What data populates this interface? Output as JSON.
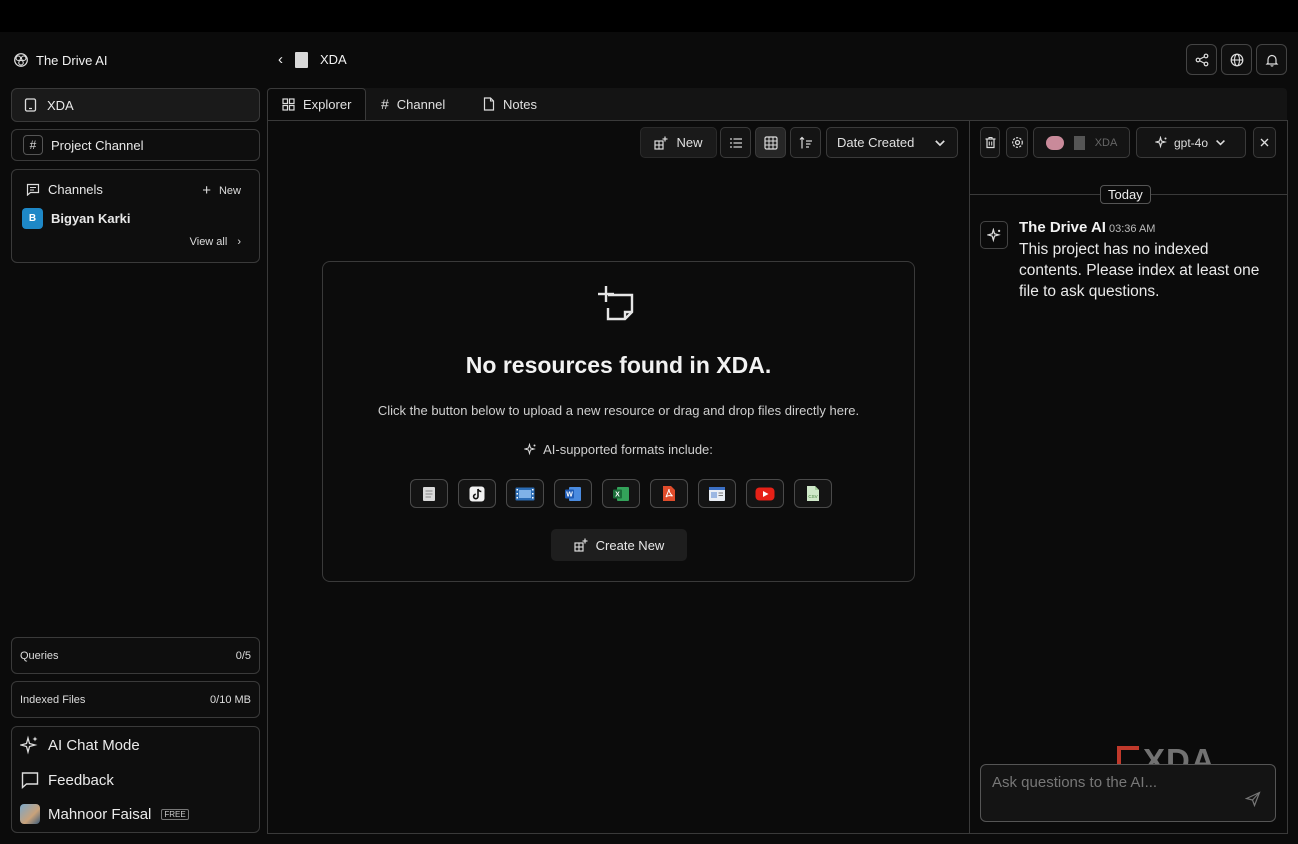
{
  "app": {
    "brand": "The Drive AI"
  },
  "sidebar": {
    "workspace": "XDA",
    "project_channel": "Project Channel",
    "channels": {
      "title": "Channels",
      "new_label": "New",
      "user": "Bigyan Karki",
      "user_initial": "B",
      "view_all": "View all"
    },
    "queries": {
      "label": "Queries",
      "value": "0/5"
    },
    "indexed": {
      "label": "Indexed Files",
      "value": "0/10 MB"
    },
    "ai_chat_mode": "AI Chat Mode",
    "feedback": "Feedback",
    "user_name": "Mahnoor Faisal",
    "plan_badge": "FREE"
  },
  "header": {
    "title": "XDA"
  },
  "tabs": [
    {
      "label": "Explorer"
    },
    {
      "label": "Channel"
    },
    {
      "label": "Notes"
    }
  ],
  "toolbar": {
    "new_label": "New",
    "sort_label": "Date Created"
  },
  "empty_state": {
    "title": "No resources found in XDA.",
    "subtitle": "Click the button below to upload a new resource or drag and drop files directly here.",
    "formats_label": "AI-supported formats include:",
    "formats": [
      "document",
      "tiktok",
      "video",
      "word",
      "excel",
      "pdf",
      "web",
      "youtube",
      "csv"
    ],
    "create_label": "Create New"
  },
  "chat": {
    "context_label": "XDA",
    "model": "gpt-4o",
    "date_divider": "Today",
    "message": {
      "author": "The Drive AI",
      "time": "03:36 AM",
      "text": "This project has no indexed contents. Please index at least one file to ask questions."
    },
    "input_placeholder": "Ask questions to the AI..."
  },
  "watermark": {
    "text": "XDA"
  },
  "colors": {
    "accent_blue": "#1e88c7",
    "background": "#0b0b0b",
    "border": "#3a3a3a"
  }
}
